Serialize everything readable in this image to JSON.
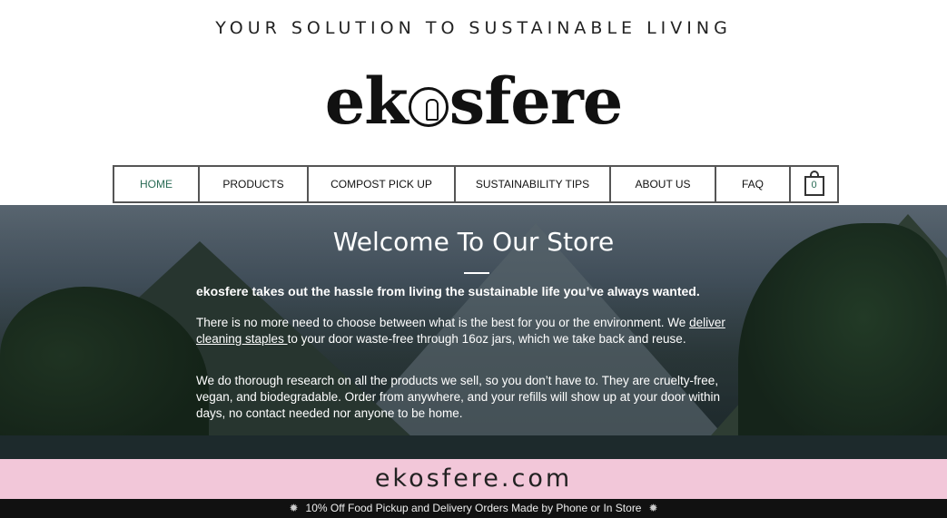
{
  "header": {
    "tagline": "YOUR SOLUTION TO SUSTAINABLE LIVING",
    "logo_prefix": "ek",
    "logo_suffix": "sfere"
  },
  "nav": {
    "items": [
      {
        "label": "HOME",
        "active": true
      },
      {
        "label": "PRODUCTS"
      },
      {
        "label": "COMPOST PICK UP"
      },
      {
        "label": "SUSTAINABILITY TIPS"
      },
      {
        "label": "ABOUT US"
      },
      {
        "label": "FAQ"
      }
    ],
    "cart_count": "0"
  },
  "hero": {
    "title": "Welcome To Our Store",
    "lead": "ekosfere takes out the hassle from living the sustainable life you’ve always wanted.",
    "p1_before": "There is no more need to choose between what is the best for you or the environment. We ",
    "p1_link": "deliver cleaning staples ",
    "p1_after": "to your door waste-free through 16oz jars, which we take back and reuse.",
    "p2": "We do thorough research on all the products we sell, so you don’t have to. They are cruelty-free, vegan, and biodegradable. Order from anywhere, and your refills will show up at your door within days, no contact needed nor anyone to be home."
  },
  "banner": {
    "domain": "ekosfere.com"
  },
  "promo": {
    "text": "10% Off Food Pickup and Delivery Orders Made by Phone or In Store",
    "burst_glyph": "✹"
  },
  "colors": {
    "accent_green": "#2a6b55",
    "banner_pink": "#f2c7d9",
    "promo_bg": "#111111"
  }
}
